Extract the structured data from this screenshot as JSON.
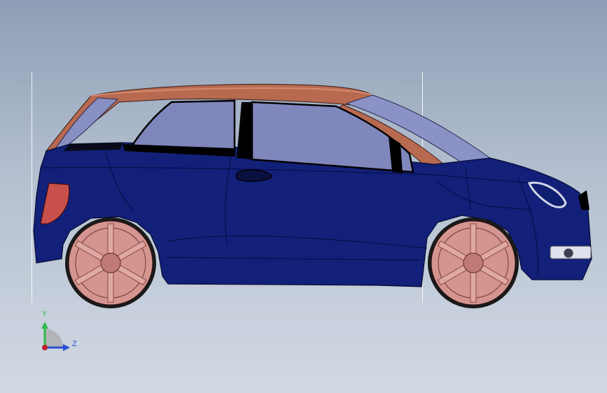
{
  "viewport": {
    "plane_label_left": "Plane",
    "plane_label_right": "Plane"
  },
  "triad": {
    "y_label": "Y",
    "z_label": "Z",
    "y_color": "#2fb84a",
    "z_color": "#2a4fd0",
    "origin_color": "#c0202a"
  },
  "model": {
    "body_color": "#12207a",
    "roof_color": "#b86a50",
    "glass_color": "#7d86b8",
    "wheel_color": "#d49490",
    "tail_light_color": "#c8504a"
  }
}
